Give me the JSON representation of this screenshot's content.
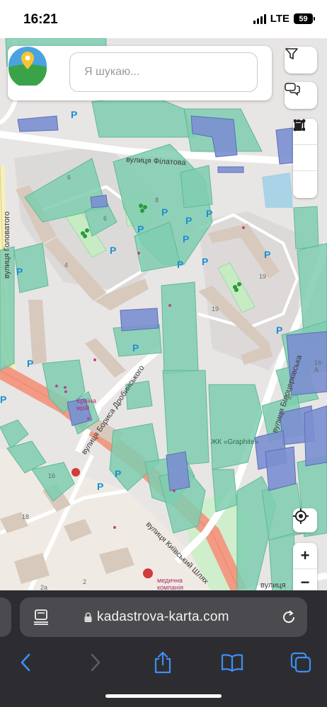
{
  "status_bar": {
    "time": "16:21",
    "network": "LTE",
    "battery": "59"
  },
  "search": {
    "placeholder": "Я шукаю..."
  },
  "map": {
    "streets": {
      "filatova": "вулиця Філатова",
      "holovatoho": "вулиця Головатого",
      "doroshenka": "вулиця Бориса Дробинського",
      "kyivskyi_shliakh": "вулиця Київський Шлях",
      "biloiidivka": "вулиця Білоцерківська",
      "bottom_right": "вулиця"
    },
    "house_numbers": [
      "6",
      "8",
      "6",
      "4",
      "19",
      "19",
      "16",
      "18",
      "16",
      "2",
      "2а",
      "16-А"
    ],
    "places": {
      "graphite": "ЖК «Graphite»",
      "shop": "Країна мрій",
      "pharmacy": "медична компанія"
    },
    "parking_label": "P"
  },
  "controls": {
    "filter_icon": "filter-icon",
    "chat_icon": "chat-icon",
    "line_tool_icon": "line-icon",
    "polygon_tool_icon": "polygon-icon",
    "delete_tool_icon": "trash-icon",
    "locate_icon": "locate-icon",
    "zoom_in": "+",
    "zoom_out": "−"
  },
  "browser": {
    "url": "kadastrova-karta.com"
  },
  "colors": {
    "building_green": "#7fceb0",
    "building_blue": "#7b8fd0",
    "road_main": "#f0a08a",
    "parking": "#1b8fd0"
  }
}
